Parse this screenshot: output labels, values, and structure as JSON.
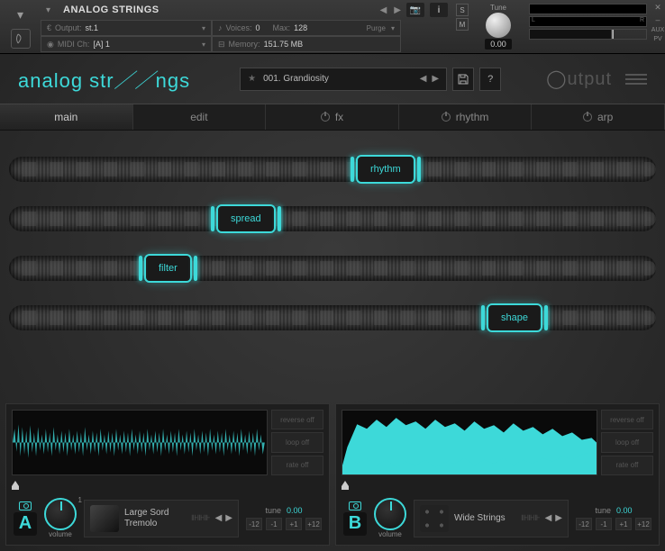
{
  "kontakt": {
    "instrument_name": "ANALOG STRINGS",
    "output_label": "Output:",
    "output_value": "st.1",
    "midi_label": "MIDI Ch:",
    "midi_value": "[A] 1",
    "voices_label": "Voices:",
    "voices_value": "0",
    "max_label": "Max:",
    "max_value": "128",
    "memory_label": "Memory:",
    "memory_value": "151.75 MB",
    "purge": "Purge",
    "s": "S",
    "m": "M",
    "tune_label": "Tune",
    "tune_value": "0.00",
    "close": "✕",
    "min": "–",
    "aux": "AUX",
    "pv": "PV"
  },
  "logo": {
    "part1": "analog str",
    "part2": "ngs",
    "output": "utput"
  },
  "preset": {
    "name": "001. Grandiosity",
    "help": "?"
  },
  "tabs": {
    "main": "main",
    "edit": "edit",
    "fx": "fx",
    "rhythm": "rhythm",
    "arp": "arp"
  },
  "macros": [
    {
      "label": "rhythm",
      "pos": 385
    },
    {
      "label": "spread",
      "pos": 230
    },
    {
      "label": "filter",
      "pos": 150
    },
    {
      "label": "shape",
      "pos": 530
    }
  ],
  "side_buttons": {
    "reverse": "reverse off",
    "loop": "loop off",
    "rate": "rate off"
  },
  "layerA": {
    "letter": "A",
    "volume_label": "volume",
    "volume_num": "1",
    "sound_name": "Large Sord Tremolo",
    "tune_label": "tune",
    "tune_value": "0.00",
    "btns": [
      "-12",
      "-1",
      "+1",
      "+12"
    ]
  },
  "layerB": {
    "letter": "B",
    "volume_label": "volume",
    "volume_num": "",
    "sound_name": "Wide Strings",
    "tune_label": "tune",
    "tune_value": "0.00",
    "btns": [
      "-12",
      "-1",
      "+1",
      "+12"
    ]
  }
}
